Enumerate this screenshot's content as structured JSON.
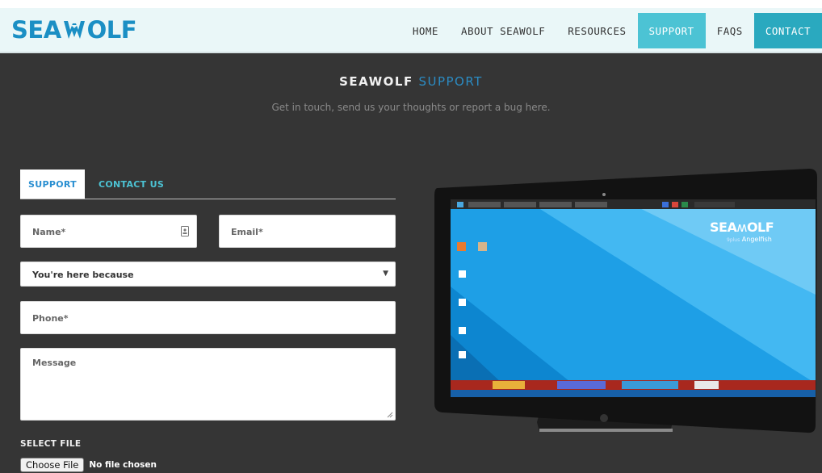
{
  "brand": {
    "logo_left": "SEA",
    "logo_right": "OLF",
    "logo_icon": "wolf-head-w-icon",
    "color": "#1b8fc4"
  },
  "nav": {
    "items": [
      {
        "label": "HOME",
        "state": "normal"
      },
      {
        "label": "ABOUT SEAWOLF",
        "state": "normal"
      },
      {
        "label": "RESOURCES",
        "state": "normal"
      },
      {
        "label": "SUPPORT",
        "state": "active"
      },
      {
        "label": "FAQS",
        "state": "normal"
      },
      {
        "label": "CONTACT",
        "state": "highlight"
      }
    ],
    "active_color": "#4cc3d4",
    "highlight_color": "#2aa9bf"
  },
  "hero": {
    "title_main": "SEAWOLF",
    "title_accent": "SUPPORT",
    "subtitle": "Get in touch, send us your thoughts or report a bug here."
  },
  "form": {
    "tabs": [
      {
        "label": "SUPPORT",
        "active": true
      },
      {
        "label": "CONTACT US",
        "active": false
      }
    ],
    "name_placeholder": "Name*",
    "email_placeholder": "Email*",
    "reason_selected": "You're here because",
    "phone_placeholder": "Phone*",
    "message_placeholder": "Message",
    "file_label": "SELECT FILE",
    "file_button": "Choose File",
    "file_status": "No file chosen"
  },
  "device_screen": {
    "logo_left": "SEA",
    "logo_right": "OLF",
    "edition": "Angelfish",
    "edition_prefix": "9plus"
  }
}
